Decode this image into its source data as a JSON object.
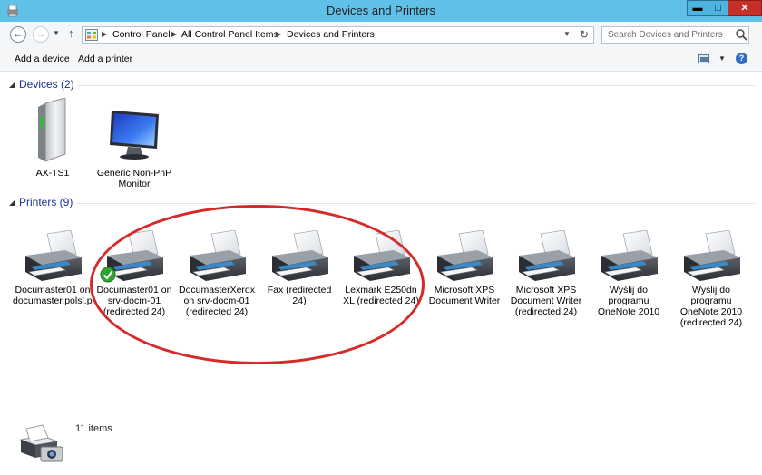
{
  "window": {
    "title": "Devices and Printers"
  },
  "titlebar": {
    "min": "▬",
    "max": "□",
    "close": "✕"
  },
  "nav": {
    "back_icon": "back-arrow-icon",
    "forward_icon": "forward-arrow-icon",
    "up_icon": "up-arrow-icon",
    "breadcrumb": [
      "Control Panel",
      "All Control Panel Items",
      "Devices and Printers"
    ],
    "search_placeholder": "Search Devices and Printers"
  },
  "toolbar": {
    "add_device": "Add a device",
    "add_printer": "Add a printer"
  },
  "groups": {
    "devices": {
      "label": "Devices (2)"
    },
    "printers": {
      "label": "Printers (9)"
    }
  },
  "devices": [
    {
      "label": "AX-TS1",
      "icon": "computer-tower-icon"
    },
    {
      "label": "Generic Non-PnP Monitor",
      "icon": "monitor-icon"
    }
  ],
  "printers": [
    {
      "label": "Documaster01 on documaster.polsl.pl",
      "icon": "printer-icon",
      "default": false
    },
    {
      "label": "Documaster01 on srv-docm-01 (redirected 24)",
      "icon": "printer-icon",
      "default": true
    },
    {
      "label": "DocumasterXerox on srv-docm-01 (redirected 24)",
      "icon": "printer-icon",
      "default": false
    },
    {
      "label": "Fax (redirected 24)",
      "icon": "printer-icon",
      "default": false
    },
    {
      "label": "Lexmark E250dn XL (redirected 24)",
      "icon": "printer-icon",
      "default": false
    },
    {
      "label": "Microsoft XPS Document Writer",
      "icon": "printer-icon",
      "default": false
    },
    {
      "label": "Microsoft XPS Document Writer (redirected 24)",
      "icon": "printer-icon",
      "default": false
    },
    {
      "label": "Wyślij do programu OneNote 2010",
      "icon": "printer-icon",
      "default": false
    },
    {
      "label": "Wyślij do programu OneNote 2010 (redirected 24)",
      "icon": "printer-icon",
      "default": false
    }
  ],
  "details": {
    "count": "11 items"
  },
  "colors": {
    "titlebar": "#5fc0e8",
    "group_header_text": "#1e3287",
    "annotation_circle": "#d52a2a",
    "close_button": "#c7302a"
  }
}
